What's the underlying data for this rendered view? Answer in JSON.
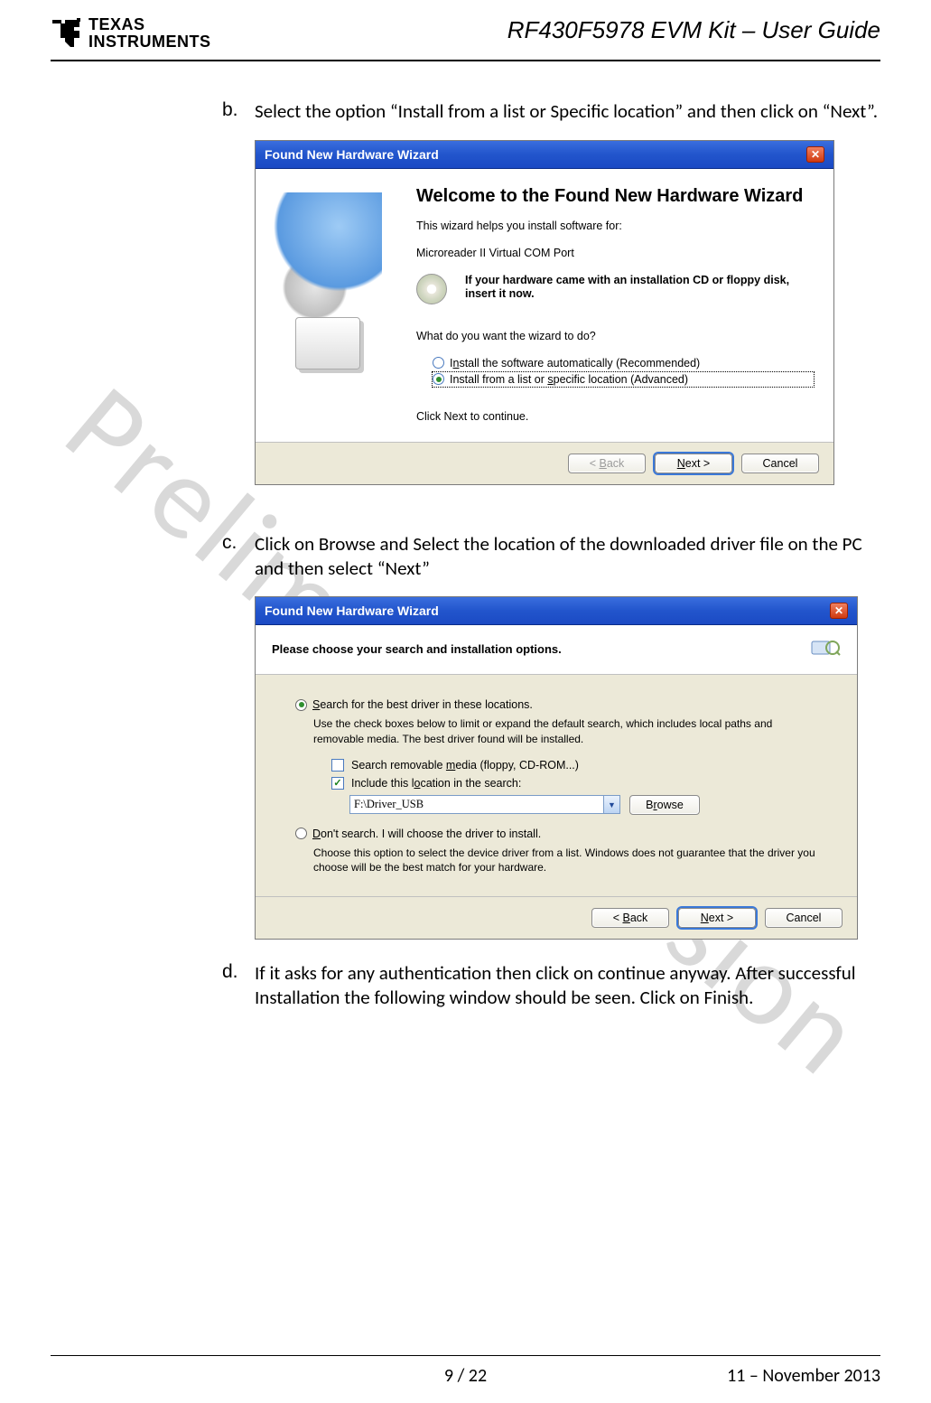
{
  "header": {
    "logo_line1": "TEXAS",
    "logo_line2": "INSTRUMENTS",
    "doc_title": "RF430F5978 EVM Kit – User Guide"
  },
  "watermark": "Preliminary Version",
  "steps": {
    "b": {
      "marker": "b.",
      "text": "Select the option “Install from a list or Specific location” and then click on “Next”."
    },
    "c": {
      "marker": "c.",
      "text": "Click on Browse and Select the location of the downloaded driver file on the PC and then select “Next”"
    },
    "d": {
      "marker": "d.",
      "text": "If it asks for any authentication then click on continue anyway. After successful Installation the following window should be seen. Click on Finish."
    }
  },
  "wizard1": {
    "title": "Found New Hardware Wizard",
    "heading": "Welcome to the Found New Hardware Wizard",
    "intro": "This wizard helps you install software for:",
    "device": "Microreader II Virtual COM Port",
    "cd_prompt": "If your hardware came with an installation CD or floppy disk, insert it now.",
    "question": "What do you want the wizard to do?",
    "opt_auto": "Install the software automatically (Recommended)",
    "opt_list": "Install from a list or specific location (Advanced)",
    "continue": "Click Next to continue.",
    "btn_back": "< Back",
    "btn_next": "Next >",
    "btn_cancel": "Cancel"
  },
  "wizard2": {
    "title": "Found New Hardware Wizard",
    "heading": "Please choose your search and installation options.",
    "opt_search": "Search for the best driver in these locations.",
    "search_sub": "Use the check boxes below to limit or expand the default search, which includes local paths and removable media. The best driver found will be installed.",
    "chk_removable": "Search removable media (floppy, CD-ROM...)",
    "chk_include": "Include this location in the search:",
    "path": "F:\\Driver_USB",
    "btn_browse": "Browse",
    "opt_dont": "Don't search. I will choose the driver to install.",
    "dont_sub": "Choose this option to select the device driver from a list.  Windows does not guarantee that the driver you choose will be the best match for your hardware.",
    "btn_back": "< Back",
    "btn_next": "Next >",
    "btn_cancel": "Cancel"
  },
  "footer": {
    "page": "9 / 22",
    "date": "11 – November  2013"
  }
}
